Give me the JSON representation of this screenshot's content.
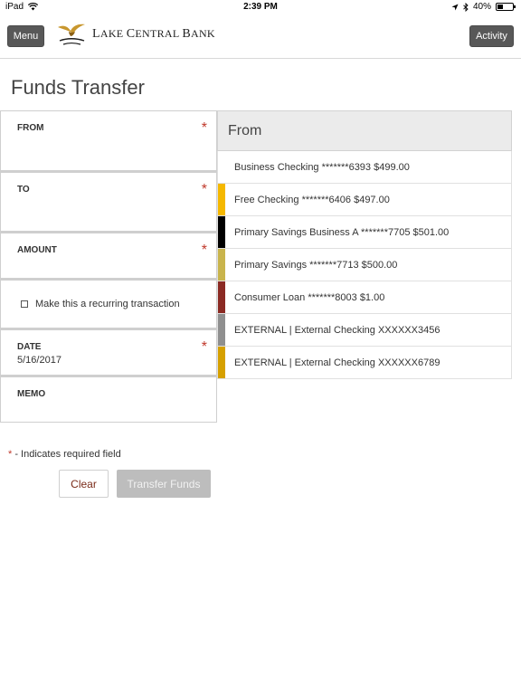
{
  "status_bar": {
    "device": "iPad",
    "time": "2:39 PM",
    "battery": "40%",
    "battery_level": 0.4
  },
  "header": {
    "menu_label": "Menu",
    "activity_label": "Activity",
    "bank_name_l": "L",
    "bank_name_ake": "AKE ",
    "bank_name_c": "C",
    "bank_name_entral": "ENTRAL ",
    "bank_name_b": "B",
    "bank_name_ank": "ANK"
  },
  "page": {
    "title": "Funds Transfer"
  },
  "form": {
    "from_label": "FROM",
    "to_label": "TO",
    "amount_label": "AMOUNT",
    "recurring_label": "Make this a recurring transaction",
    "date_label": "DATE",
    "date_value": "5/16/2017",
    "memo_label": "MEMO",
    "required_mark": "*"
  },
  "required_note": {
    "star": "*",
    "text": " - Indicates required field"
  },
  "buttons": {
    "clear": "Clear",
    "transfer": "Transfer Funds"
  },
  "accounts_panel": {
    "title": "From",
    "accounts": [
      {
        "label": "Business Checking *******6393 $499.00",
        "color": "#ffffff"
      },
      {
        "label": "Free Checking *******6406 $497.00",
        "color": "#f5b800"
      },
      {
        "label": "Primary Savings Business A *******7705 $501.00",
        "color": "#000000"
      },
      {
        "label": "Primary Savings *******7713 $500.00",
        "color": "#c9b44c"
      },
      {
        "label": "Consumer Loan *******8003 $1.00",
        "color": "#8b2a23"
      },
      {
        "label": "EXTERNAL | External Checking XXXXXX3456",
        "color": "#8f8f8f"
      },
      {
        "label": "EXTERNAL | External Checking XXXXXX6789",
        "color": "#d6a000"
      }
    ]
  }
}
